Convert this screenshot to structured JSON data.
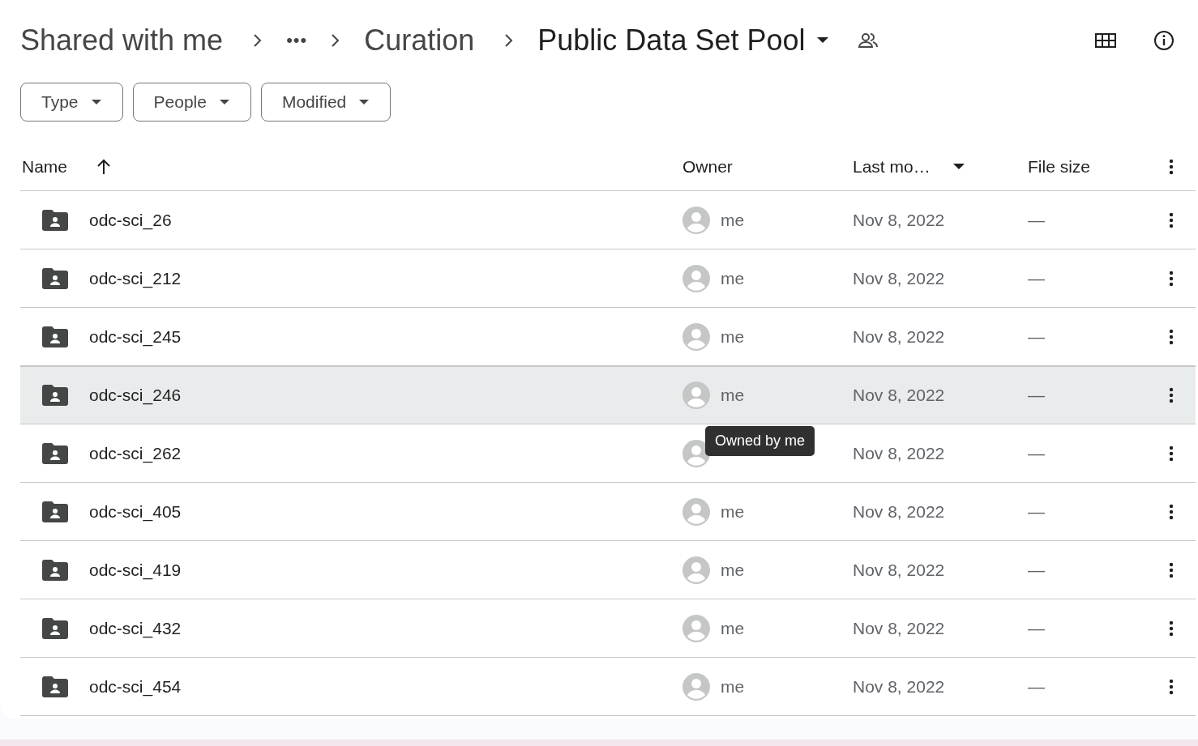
{
  "breadcrumb": [
    {
      "label": "Shared with me",
      "kind": "link"
    },
    {
      "label": "•••",
      "kind": "more"
    },
    {
      "label": "Curation",
      "kind": "link"
    },
    {
      "label": "Public Data Set Pool",
      "kind": "current"
    }
  ],
  "filters": [
    {
      "label": "Type"
    },
    {
      "label": "People"
    },
    {
      "label": "Modified"
    }
  ],
  "columns": [
    {
      "label": "Name",
      "kind": "sorted"
    },
    {
      "label": "Owner",
      "kind": "plain"
    },
    {
      "label": "Last mo…",
      "kind": "dropdown"
    },
    {
      "label": "File size",
      "kind": "plain"
    }
  ],
  "rows": [
    {
      "name": "odc-sci_26",
      "owner": "me",
      "modified": "Nov 8, 2022",
      "size": "—",
      "hovered": false
    },
    {
      "name": "odc-sci_212",
      "owner": "me",
      "modified": "Nov 8, 2022",
      "size": "—",
      "hovered": false
    },
    {
      "name": "odc-sci_245",
      "owner": "me",
      "modified": "Nov 8, 2022",
      "size": "—",
      "hovered": false
    },
    {
      "name": "odc-sci_246",
      "owner": "me",
      "modified": "Nov 8, 2022",
      "size": "—",
      "hovered": true
    },
    {
      "name": "odc-sci_262",
      "modified": "Nov 8, 2022",
      "size": "—",
      "hovered": false,
      "tooltip": "Owned by me"
    },
    {
      "name": "odc-sci_405",
      "owner": "me",
      "modified": "Nov 8, 2022",
      "size": "—",
      "hovered": false
    },
    {
      "name": "odc-sci_419",
      "owner": "me",
      "modified": "Nov 8, 2022",
      "size": "—",
      "hovered": false
    },
    {
      "name": "odc-sci_432",
      "owner": "me",
      "modified": "Nov 8, 2022",
      "size": "—",
      "hovered": false
    },
    {
      "name": "odc-sci_454",
      "owner": "me",
      "modified": "Nov 8, 2022",
      "size": "—",
      "hovered": false
    }
  ]
}
